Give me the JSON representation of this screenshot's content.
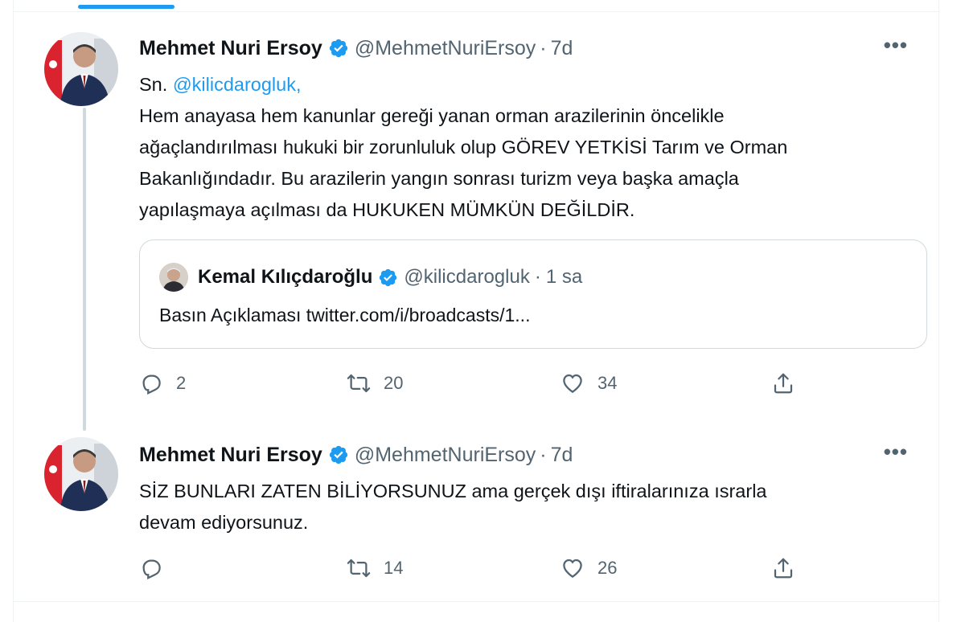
{
  "tweets": [
    {
      "author_name": "Mehmet Nuri Ersoy",
      "handle": "@MehmetNuriErsoy",
      "separator": "·",
      "time": "7d",
      "more": "•••",
      "text_prefix": "Sn. ",
      "mention": "@kilicdarogluk",
      "text_line1_rest": ",",
      "text_lines": [
        "Hem anayasa hem kanunlar gereği yanan orman arazilerinin öncelikle",
        "ağaçlandırılması hukuki bir zorunluluk olup GÖREV YETKİSİ Tarım ve Orman",
        "Bakanlığındadır. Bu arazilerin yangın sonrası turizm veya başka amaçla",
        "yapılaşmaya açılması da HUKUKEN MÜMKÜN DEĞİLDİR."
      ],
      "quote": {
        "author_name": "Kemal Kılıçdaroğlu",
        "handle": "@kilicdarogluk",
        "separator": "·",
        "time": "1 sa",
        "text": "Basın Açıklaması twitter.com/i/broadcasts/1..."
      },
      "stats": {
        "replies": "2",
        "retweets": "20",
        "likes": "34"
      }
    },
    {
      "author_name": "Mehmet Nuri Ersoy",
      "handle": "@MehmetNuriErsoy",
      "separator": "·",
      "time": "7d",
      "more": "•••",
      "text_lines": [
        "SİZ BUNLARI ZATEN BİLİYORSUNUZ ama gerçek dışı iftiralarınıza ısrarla",
        "devam ediyorsunuz."
      ],
      "stats": {
        "replies": "",
        "retweets": "14",
        "likes": "26"
      }
    }
  ],
  "colors": {
    "accent": "#1d9bf0",
    "text_primary": "#0f1419",
    "text_secondary": "#536471",
    "border": "#cfd9de"
  },
  "icons": [
    "verified-badge-icon",
    "more-icon",
    "reply-icon",
    "retweet-icon",
    "like-icon",
    "share-icon"
  ]
}
